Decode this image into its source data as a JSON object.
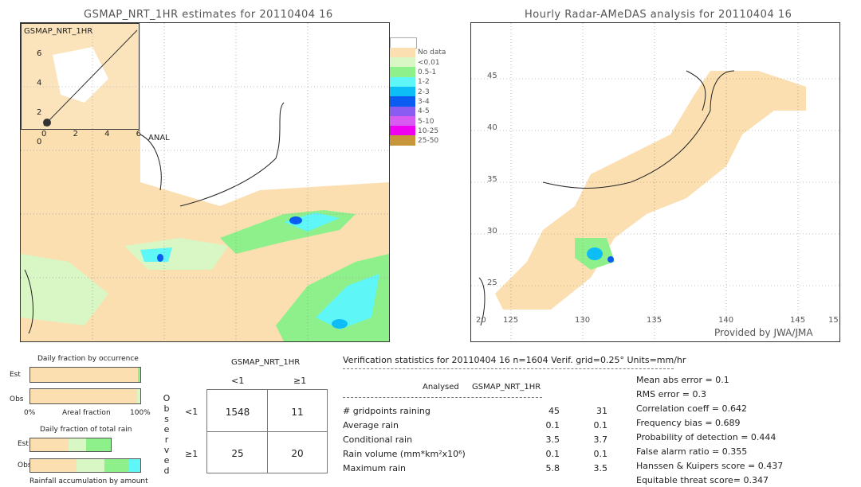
{
  "left_map": {
    "title": "GSMAP_NRT_1HR estimates for 20110404 16",
    "inset_label": "GSMAP_NRT_1HR",
    "inset_ticks_y": [
      "6",
      "4",
      "2",
      "0"
    ],
    "inset_ticks_x": [
      "0",
      "2",
      "4",
      "6"
    ],
    "anal_label": "ANAL"
  },
  "right_map": {
    "title": "Hourly Radar-AMeDAS analysis for 20110404 16",
    "lat_labels": [
      "45",
      "40",
      "35",
      "30",
      "25",
      "20"
    ],
    "lon_labels": [
      "125",
      "130",
      "135",
      "140",
      "145",
      "15"
    ],
    "credit": "Provided by JWA/JMA"
  },
  "legend": [
    {
      "label": "",
      "color": "#ffffff"
    },
    {
      "label": "No data",
      "color": "#fbdfb1"
    },
    {
      "label": "<0.01",
      "color": "#d8f7c4"
    },
    {
      "label": "0.5-1",
      "color": "#8ef08a"
    },
    {
      "label": "1-2",
      "color": "#5ef6f6"
    },
    {
      "label": "2-3",
      "color": "#0dbdf6"
    },
    {
      "label": "3-4",
      "color": "#0b5cf0"
    },
    {
      "label": "4-5",
      "color": "#8a5cf2"
    },
    {
      "label": "5-10",
      "color": "#d85cf2"
    },
    {
      "label": "10-25",
      "color": "#f000f0"
    },
    {
      "label": "25-50",
      "color": "#c8963a"
    }
  ],
  "occurrence": {
    "title": "Daily fraction by occurrence",
    "est": "Est",
    "obs": "Obs",
    "axis_left": "0%",
    "axis_mid": "Areal fraction",
    "axis_right": "100%",
    "est_fraction": 0.98,
    "obs_fraction": 0.97
  },
  "total_rain": {
    "title": "Daily fraction of total rain",
    "est": "Est",
    "obs": "Obs",
    "caption": "Rainfall accumulation by amount"
  },
  "contingency": {
    "header": "GSMAP_NRT_1HR",
    "col_lt": "<1",
    "col_ge": "≥1",
    "side_label": [
      "O",
      "b",
      "s",
      "e",
      "r",
      "v",
      "e",
      "d"
    ],
    "row_lt": "<1",
    "row_ge": "≥1",
    "cells": [
      [
        "1548",
        "11"
      ],
      [
        "25",
        "20"
      ]
    ]
  },
  "stats": {
    "header": "Verification statistics for 20110404 16  n=1604  Verif. grid=0.25°  Units=mm/hr",
    "col_analysed": "Analysed",
    "col_gsmap": "GSMAP_NRT_1HR",
    "rows": [
      {
        "label": "# gridpoints raining",
        "a": "45",
        "g": "31"
      },
      {
        "label": "Average rain",
        "a": "0.1",
        "g": "0.1"
      },
      {
        "label": "Conditional rain",
        "a": "3.5",
        "g": "3.7"
      },
      {
        "label": "Rain volume (mm*km²x10⁶)",
        "a": "0.1",
        "g": "0.1"
      },
      {
        "label": "Maximum rain",
        "a": "5.8",
        "g": "3.5"
      }
    ],
    "scores": [
      "Mean abs error = 0.1",
      "RMS error = 0.3",
      "Correlation coeff = 0.642",
      "Frequency bias = 0.689",
      "Probability of detection = 0.444",
      "False alarm ratio = 0.355",
      "Hanssen & Kuipers score = 0.437",
      "Equitable threat score= 0.347"
    ]
  }
}
